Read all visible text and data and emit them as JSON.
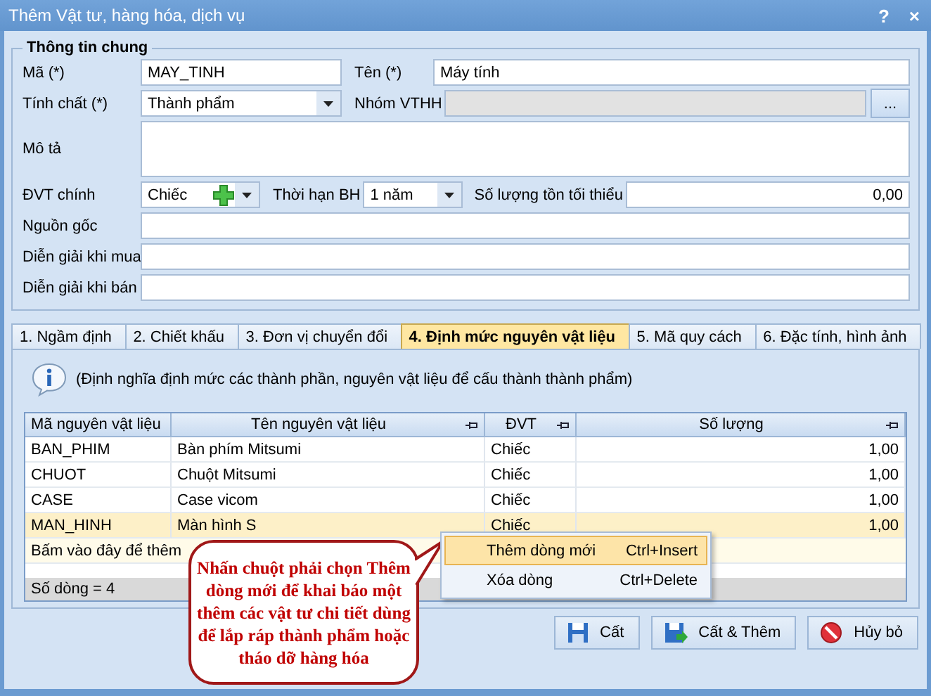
{
  "window": {
    "title": "Thêm Vật tư, hàng hóa, dịch vụ",
    "help": "?",
    "close": "×"
  },
  "general": {
    "legend": "Thông tin chung",
    "code": {
      "label": "Mã (*)",
      "value": "MAY_TINH"
    },
    "name": {
      "label": "Tên (*)",
      "value": "Máy tính"
    },
    "nature": {
      "label": "Tính chất (*)",
      "value": "Thành phẩm"
    },
    "group": {
      "label": "Nhóm VTHH",
      "disabled": true,
      "browse": "..."
    },
    "description": {
      "label": "Mô tả"
    },
    "unit": {
      "label": "ĐVT chính",
      "value": "Chiếc"
    },
    "warranty": {
      "label": "Thời hạn BH",
      "value": "1 năm"
    },
    "min_stock": {
      "label": "Số lượng tồn tối thiểu",
      "value": "0,00"
    },
    "origin": {
      "label": "Nguồn gốc"
    },
    "purchase_note": {
      "label": "Diễn giải khi mua"
    },
    "sale_note": {
      "label": "Diễn giải khi bán"
    }
  },
  "tabs": [
    {
      "label": "1. Ngầm định",
      "selected": false
    },
    {
      "label": "2. Chiết khấu",
      "selected": false
    },
    {
      "label": "3. Đơn vị chuyển đổi",
      "selected": false
    },
    {
      "label": "4. Định mức nguyên vật liệu",
      "selected": true
    },
    {
      "label": "5. Mã quy cách",
      "selected": false
    },
    {
      "label": "6. Đặc tính, hình ảnh",
      "selected": false
    }
  ],
  "info": "(Định nghĩa định mức các thành phần, nguyên vật liệu để cấu thành thành phẩm)",
  "table": {
    "columns": [
      "Mã nguyên vật liệu",
      "Tên nguyên vật liệu",
      "ĐVT",
      "Số lượng"
    ],
    "rows": [
      {
        "cells": [
          "BAN_PHIM",
          "Bàn phím Mitsumi",
          "Chiếc",
          "1,00"
        ],
        "selected": false
      },
      {
        "cells": [
          "CHUOT",
          "Chuột Mitsumi",
          "Chiếc",
          "1,00"
        ],
        "selected": false
      },
      {
        "cells": [
          "CASE",
          "Case vicom",
          "Chiếc",
          "1,00"
        ],
        "selected": false
      },
      {
        "cells": [
          "MAN_HINH",
          "Màn hình S",
          "Chiếc",
          "1,00"
        ],
        "selected": true
      }
    ],
    "add_row_hint": "Bấm vào đây để thêm",
    "footer": "Số dòng = 4"
  },
  "context_menu": [
    {
      "label": "Thêm dòng mới",
      "shortcut": "Ctrl+Insert",
      "selected": true
    },
    {
      "label": "Xóa dòng",
      "shortcut": "Ctrl+Delete",
      "selected": false
    }
  ],
  "callout": "Nhấn chuột phải chọn Thêm dòng mới để khai báo một thêm các vật tư chi tiết dùng để lắp ráp thành phẩm hoặc tháo dỡ hàng hóa",
  "buttons": [
    {
      "kind": "save",
      "label": "Cất"
    },
    {
      "kind": "save_add",
      "label": "Cất & Thêm"
    },
    {
      "kind": "cancel",
      "label": "Hủy bỏ"
    }
  ]
}
